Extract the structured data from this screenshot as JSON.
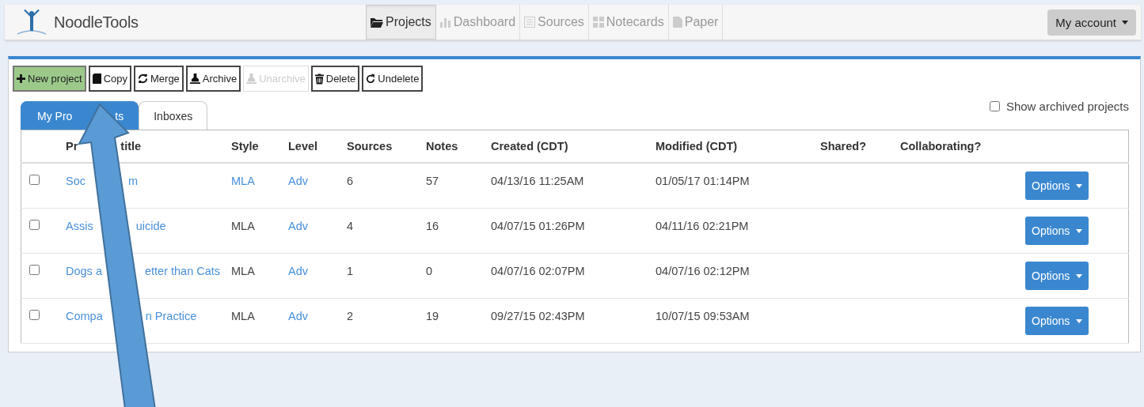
{
  "app": {
    "name": "NoodleTools"
  },
  "nav": [
    {
      "label": "Projects",
      "selected": true,
      "disabled": false
    },
    {
      "label": "Dashboard",
      "selected": false,
      "disabled": true
    },
    {
      "label": "Sources",
      "selected": false,
      "disabled": true
    },
    {
      "label": "Notecards",
      "selected": false,
      "disabled": true
    },
    {
      "label": "Paper",
      "selected": false,
      "disabled": true
    }
  ],
  "account_button": "My account",
  "toolbar": [
    {
      "label": "New project",
      "kind": "primary",
      "disabled": false
    },
    {
      "label": "Copy",
      "kind": "default",
      "disabled": false
    },
    {
      "label": "Merge",
      "kind": "default",
      "disabled": false
    },
    {
      "label": "Archive",
      "kind": "default",
      "disabled": false
    },
    {
      "label": "Unarchive",
      "kind": "default",
      "disabled": true
    },
    {
      "label": "Delete",
      "kind": "default",
      "disabled": false
    },
    {
      "label": "Undelete",
      "kind": "default",
      "disabled": false
    }
  ],
  "tabs": [
    {
      "label_parts": [
        "My Pro",
        "ts"
      ],
      "selected": true
    },
    {
      "label_parts": [
        "Inboxes"
      ],
      "selected": false
    }
  ],
  "show_archived": {
    "label": "Show archived projects",
    "checked": false
  },
  "table": {
    "columns": [
      {
        "parts": [
          "Pr",
          "title"
        ]
      },
      {
        "parts": [
          "Style"
        ]
      },
      {
        "parts": [
          "Level"
        ]
      },
      {
        "parts": [
          "Sources"
        ]
      },
      {
        "parts": [
          "Notes"
        ]
      },
      {
        "parts": [
          "Created (CDT)"
        ]
      },
      {
        "parts": [
          "Modified (CDT)"
        ]
      },
      {
        "parts": [
          "Shared?"
        ]
      },
      {
        "parts": [
          "Collaborating?"
        ]
      }
    ],
    "rows": [
      {
        "checked": false,
        "title_parts": [
          "Soc",
          "m"
        ],
        "style": "MLA",
        "style_link": true,
        "level": "Adv",
        "sources": "6",
        "notes": "57",
        "created": "04/13/16 11:25AM",
        "modified": "01/05/17 01:14PM",
        "options": "Options"
      },
      {
        "checked": false,
        "title_parts": [
          "Assis",
          "uicide"
        ],
        "style": "MLA",
        "style_link": false,
        "level": "Adv",
        "sources": "4",
        "notes": "16",
        "created": "04/07/15 01:26PM",
        "modified": "04/11/16 02:21PM",
        "options": "Options"
      },
      {
        "checked": false,
        "title_parts": [
          "Dogs a",
          "etter than Cats"
        ],
        "style": "MLA",
        "style_link": false,
        "level": "Adv",
        "sources": "1",
        "notes": "0",
        "created": "04/07/16 02:07PM",
        "modified": "04/07/16 02:12PM",
        "options": "Options"
      },
      {
        "checked": false,
        "title_parts": [
          "Compa",
          "n Practice"
        ],
        "style": "MLA",
        "style_link": false,
        "level": "Adv",
        "sources": "2",
        "notes": "19",
        "created": "09/27/15 02:43PM",
        "modified": "10/07/15 09:53AM",
        "options": "Options"
      }
    ]
  }
}
